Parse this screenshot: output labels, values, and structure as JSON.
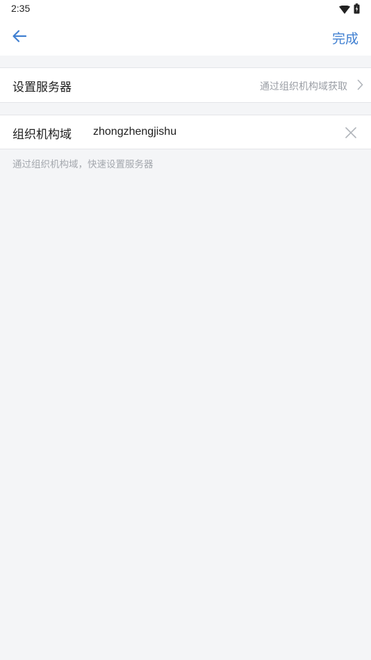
{
  "status_bar": {
    "time": "2:35",
    "icons": [
      "wifi-icon",
      "battery-icon"
    ]
  },
  "app_bar": {
    "back_icon": "arrow-left-icon",
    "done_label": "完成"
  },
  "server_row": {
    "title": "设置服务器",
    "value": "通过组织机构域获取",
    "chevron_icon": "chevron-right-icon"
  },
  "domain_row": {
    "label": "组织机构域",
    "input_value": "zhongzhengjishu",
    "clear_icon": "close-icon"
  },
  "hint": "通过组织机构域，快速设置服务器",
  "colors": {
    "accent": "#3f7fd1",
    "background": "#f4f5f7",
    "secondary_text": "#9a9ea5"
  }
}
